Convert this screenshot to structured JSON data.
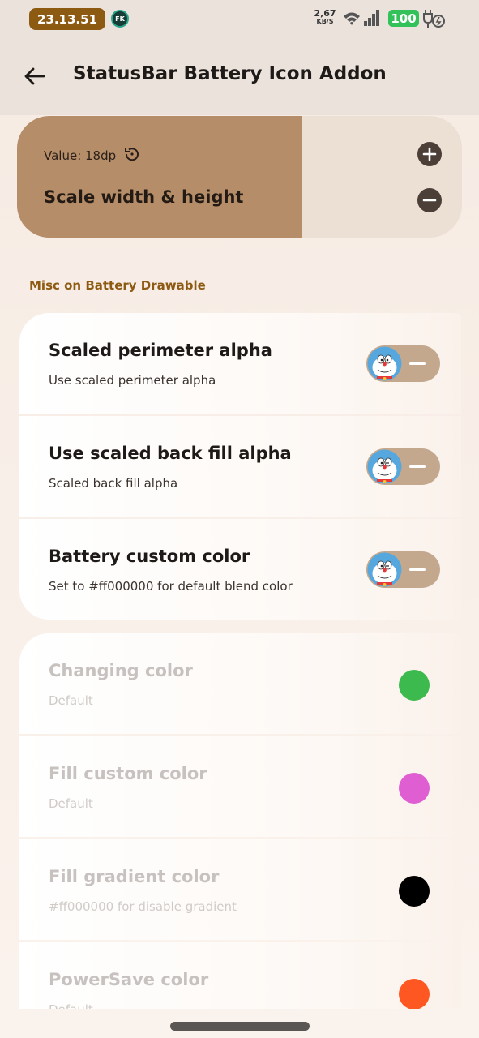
{
  "status_bar": {
    "time": "23.13.51",
    "app_badge": "FK",
    "net_speed_value": "2,67",
    "net_speed_unit": "KB/S",
    "battery_level": "100"
  },
  "header": {
    "title": "StatusBar Battery Icon Addon"
  },
  "scale_card": {
    "value_label": "Value: 18dp",
    "title": "Scale width & height",
    "fill_fraction": 0.64,
    "fill_color": "#b58d69"
  },
  "section": {
    "title": "Misc on Battery Drawable"
  },
  "toggles": [
    {
      "title": "Scaled perimeter alpha",
      "subtitle": "Use scaled perimeter alpha",
      "enabled": false
    },
    {
      "title": "Use scaled back fill alpha",
      "subtitle": "Scaled back fill alpha",
      "enabled": false
    },
    {
      "title": "Battery custom color",
      "subtitle": "Set to #ff000000 for default blend color",
      "enabled": false
    }
  ],
  "colors": [
    {
      "title": "Changing color",
      "subtitle": "Default",
      "color": "#3cba4e"
    },
    {
      "title": "Fill custom color",
      "subtitle": "Default",
      "color": "#df5fd2"
    },
    {
      "title": "Fill gradient color",
      "subtitle": "#ff000000 for disable gradient",
      "color": "#000000"
    },
    {
      "title": "PowerSave color",
      "subtitle": "Default",
      "color": "#ff5722"
    }
  ],
  "theme": {
    "accent": "#8d5a12",
    "toggle_track": "#c4a88e"
  }
}
